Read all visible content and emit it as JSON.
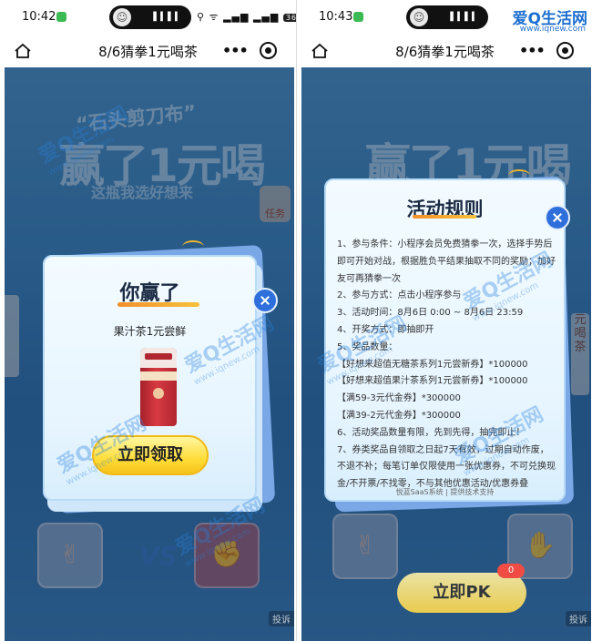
{
  "screens": {
    "left": {
      "status": {
        "time": "10:42",
        "battery": "36"
      },
      "navbar": {
        "title": "8/6猜拳1元喝茶"
      },
      "game": {
        "banner_line1": "“石头剪刀布”",
        "banner_line2": "赢了1元喝",
        "banner_line3": "这瓶我选好想来",
        "task_label": "任务",
        "side_tab_label": "",
        "report_label": "投诉"
      },
      "modal": {
        "title": "你赢了",
        "prize": "果汁茶1元尝鲜",
        "claim_button": "立即领取"
      }
    },
    "right": {
      "status": {
        "time": "10:43"
      },
      "navbar": {
        "title": "8/6猜拳1元喝茶"
      },
      "game": {
        "side_tab_label": "元喝茶",
        "pk_button": "立即PK",
        "pk_badge": "0",
        "report_label": "投诉"
      },
      "modal": {
        "title": "活动规则",
        "rules": [
          "1、参与条件：小程序会员免费猜拳一次，选择手势后即可开始对战，根据胜负平结果抽取不同的奖励；加好友可再猜拳一次",
          "2、参与方式：点击小程序参与",
          "3、活动时间：8月6日 0:00 ~ 8月6日 23:59",
          "4、开奖方式：即抽即开",
          "5、奖品数量：",
          "【好想来超值无糖茶系列1元尝新券】*100000",
          "【好想来超值果汁茶系列1元尝新券】*100000",
          "【满59-3元代金券】*300000",
          "【满39-2元代金券】*300000",
          "6、活动奖品数量有限，先到先得，抽完即止！",
          "7、券类奖品自领取之日起7天有效，过期自动作废，不退不补；每笔订单仅限使用一张优惠券，不可兑换现金/不开票/不找零，不与其他优惠活动/优惠券叠"
        ],
        "footer": "悦蓝SaaS系统 | 提供技术支持"
      }
    }
  },
  "watermark": {
    "text": "爱Q生活网",
    "url": "www.iqnew.com"
  },
  "site_logo": {
    "name": "爱Q生活网",
    "url": "www.iqnew.com"
  },
  "colors": {
    "accent_blue": "#2f6fdc",
    "button_yellow": "#ffde3a",
    "badge_red": "#f04c43",
    "game_bg": "#3b7fb5"
  },
  "icons": [
    "home-icon",
    "more-icon",
    "target-icon",
    "close-icon",
    "message-icon"
  ]
}
